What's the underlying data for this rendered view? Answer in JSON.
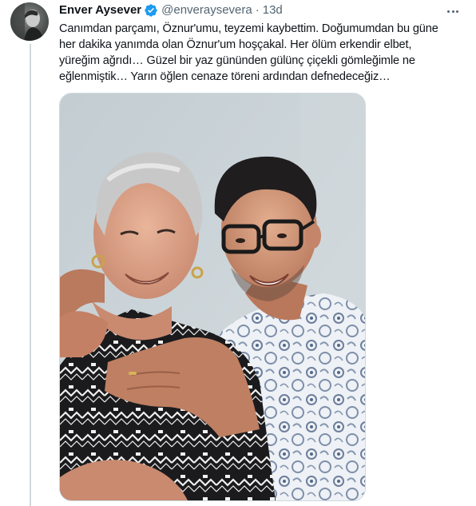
{
  "tweet": {
    "author": {
      "display_name": "Enver Aysever",
      "handle": "@enveraysevera",
      "verified": true,
      "avatar_icon": "profile-photo"
    },
    "separator": "·",
    "time": "13d",
    "more_icon": "more-dots-icon",
    "text_lines": [
      "Canımdan parçamı, Öznur'umu, teyzemi kaybettim. Doğumumdan bu güne",
      "her dakika yanımda olan Öznur'um hoşçakal. Her ölüm erkendir elbet,",
      "yüreğim ağrıdı… Güzel bir yaz gününden gülünç çiçekli gömleğimle ne",
      "eğlenmiştik… Yarın öğlen cenaze töreni ardından defnedeceğiz…"
    ],
    "media": {
      "type": "photo"
    }
  },
  "colors": {
    "text": "#0f1419",
    "secondary": "#536471",
    "verified": "#1d9bf0",
    "border": "#cfd9de"
  }
}
